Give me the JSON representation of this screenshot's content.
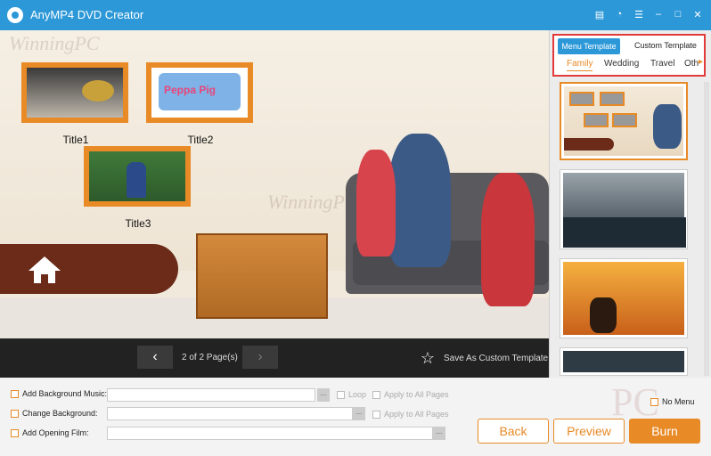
{
  "app": {
    "title": "AnyMP4 DVD Creator"
  },
  "titlebar_icons": [
    "file-icon",
    "chat-icon",
    "menu-icon",
    "minimize-icon",
    "maximize-icon",
    "close-icon"
  ],
  "preview": {
    "watermark": "WinningPC",
    "titles": [
      "Title1",
      "Title2",
      "Title3"
    ],
    "thumb2_text": "Peppa Pig"
  },
  "pager": {
    "page_text": "2 of 2 Page(s)",
    "save_template": "Save As Custom Template"
  },
  "side": {
    "tabs": [
      "Menu Template",
      "Custom Template"
    ],
    "categories": [
      "Family",
      "Wedding",
      "Travel",
      "Oth"
    ]
  },
  "options": {
    "background_music": "Add Background Music:",
    "change_background": "Change Background:",
    "opening_film": "Add Opening Film:",
    "loop": "Loop",
    "apply_all_1": "Apply to All Pages",
    "apply_all_2": "Apply to All Pages",
    "browse": "...",
    "no_menu": "No Menu"
  },
  "buttons": {
    "back": "Back",
    "preview": "Preview",
    "burn": "Burn"
  },
  "bg_watermark": "PC",
  "colors": {
    "accent": "#e88a26",
    "titlebar": "#2c98d8",
    "highlight": "#e23a3a"
  }
}
